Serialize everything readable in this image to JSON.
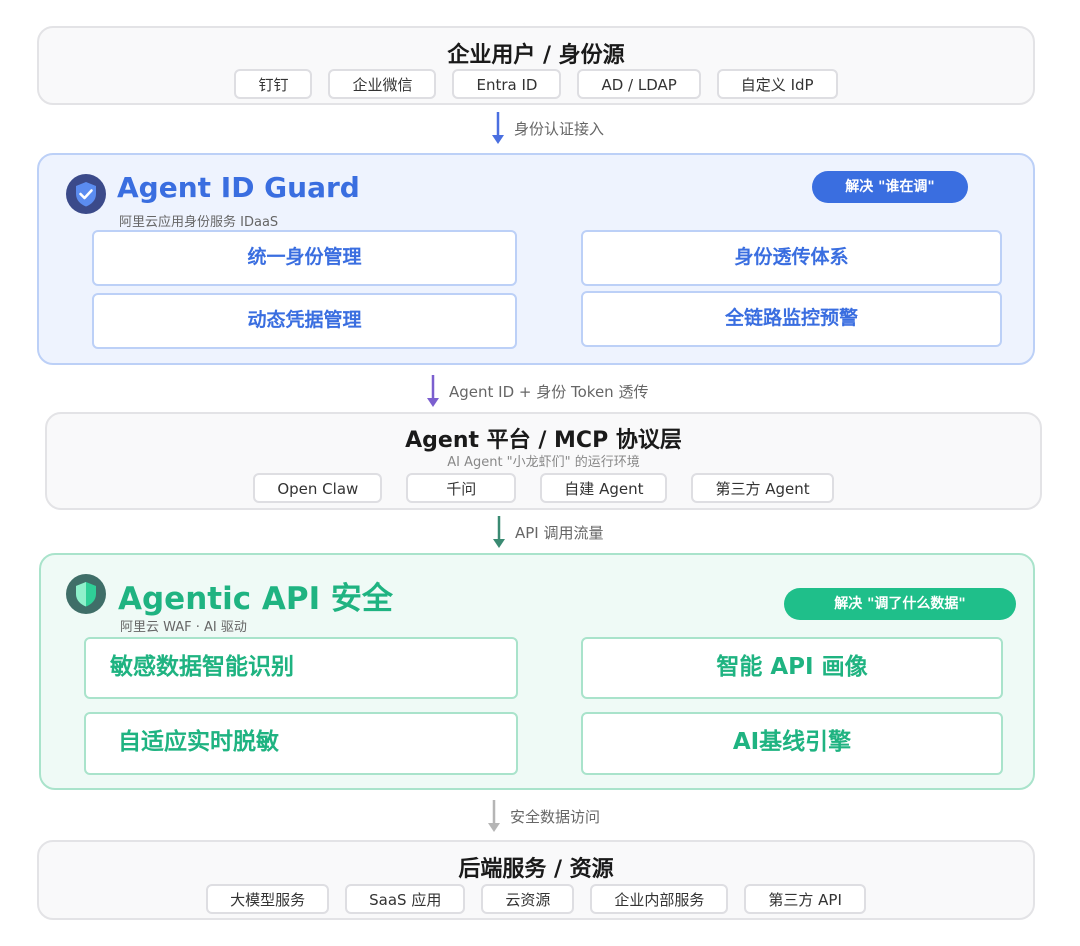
{
  "top": {
    "title": "企业用户 / 身份源",
    "chips": [
      "钉钉",
      "企业微信",
      "Entra ID",
      "AD / LDAP",
      "自定义 IdP"
    ]
  },
  "arrow1": {
    "label": "身份认证接入"
  },
  "guard": {
    "title": "Agent ID Guard",
    "subtitle": "阿里云应用身份服务 IDaaS",
    "badge": "解决 \"谁在调\"",
    "features": [
      "统一身份管理",
      "身份透传体系",
      "动态凭据管理",
      "全链路监控预警"
    ],
    "logo_icon": "shield-check-icon"
  },
  "arrow2": {
    "label": "Agent ID + 身份 Token 透传"
  },
  "platform": {
    "title": "Agent 平台 / MCP 协议层",
    "subtitle": "AI Agent \"小龙虾们\" 的运行环境",
    "chips": [
      "Open Claw",
      "千问",
      "自建 Agent",
      "第三方 Agent"
    ]
  },
  "arrow3": {
    "label": "API 调用流量"
  },
  "api": {
    "title": "Agentic API 安全",
    "subtitle": "阿里云 WAF · AI 驱动",
    "badge": "解决 \"调了什么数据\"",
    "features": [
      "敏感数据智能识别",
      "智能 API 画像",
      "自适应实时脱敏",
      "AI基线引擎"
    ],
    "logo_icon": "shield-half-icon"
  },
  "arrow4": {
    "label": "安全数据访问"
  },
  "backend": {
    "title": "后端服务 / 资源",
    "chips": [
      "大模型服务",
      "SaaS 应用",
      "云资源",
      "企业内部服务",
      "第三方 API"
    ]
  },
  "colors": {
    "blue_accent": "#3a6ee0",
    "green_accent": "#1fb381",
    "arrow_blue": "#4a6fe0",
    "arrow_purple": "#7b5fcf",
    "arrow_teal": "#3a8a72",
    "arrow_grey": "#b5b5b5"
  }
}
